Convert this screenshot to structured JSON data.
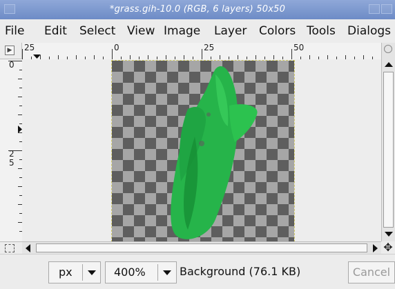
{
  "window": {
    "title": "*grass.gih-10.0 (RGB, 6 layers) 50x50"
  },
  "menu": [
    "File",
    "Edit",
    "Select",
    "View",
    "Image",
    "Layer",
    "Colors",
    "Tools",
    "Dialogs"
  ],
  "ruler_h": {
    "labels": [
      "25",
      "0",
      "25",
      "50"
    ]
  },
  "ruler_v": {
    "labels": [
      "0",
      "2",
      "5"
    ]
  },
  "statusbar": {
    "unit": "px",
    "zoom": "400%",
    "layer_info": "Background (76.1 KB)",
    "cancel_label": "Cancel"
  },
  "colors": {
    "title_bar": "#7f9ad0",
    "grass_light": "#2cc24f",
    "grass_dark": "#178f35"
  }
}
